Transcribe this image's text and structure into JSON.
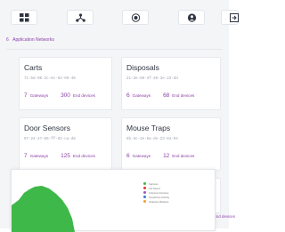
{
  "toolbar": {
    "items": [
      {
        "icon": "grid-icon"
      },
      {
        "icon": "network-icon"
      },
      {
        "icon": "record-icon"
      },
      {
        "icon": "user-icon"
      },
      {
        "icon": "exit-icon"
      }
    ]
  },
  "section": {
    "count": "6",
    "label": "Application Networks"
  },
  "networks": [
    {
      "name": "Carts",
      "id": "71-5d-06-2c-6c-84-69-48",
      "gateways": "7",
      "gateways_label": "Gateways",
      "end_devices": "300",
      "end_devices_label": "End devices"
    },
    {
      "name": "Disposals",
      "id": "21-3e-86-3f-20-3e-23-dd",
      "gateways": "6",
      "gateways_label": "Gateways",
      "end_devices": "68",
      "end_devices_label": "End devices"
    },
    {
      "name": "Door Sensors",
      "id": "67-24-47-65-ff-92-ca-d8",
      "gateways": "7",
      "gateways_label": "Gateways",
      "end_devices": "125",
      "end_devices_label": "End devices"
    },
    {
      "name": "Mouse Traps",
      "id": "6b-3c-2e-6a-de-23-63-94",
      "gateways": "6",
      "gateways_label": "Gateways",
      "end_devices": "12",
      "end_devices_label": "End devices"
    }
  ],
  "overlay": {
    "legend": [
      {
        "label": "Success",
        "color": "#3fb84a"
      },
      {
        "label": "Vol Saved",
        "color": "#e53935"
      },
      {
        "label": "Unknown Devices",
        "color": "#9c5bb5"
      },
      {
        "label": "Suspicious Activity",
        "color": "#3a7bd5"
      },
      {
        "label": "Gateway Malware",
        "color": "#f0a030"
      }
    ],
    "right_label": "End devices"
  },
  "colors": {
    "accent": "#8b3fa7",
    "chart_fill": "#3fb84a"
  }
}
